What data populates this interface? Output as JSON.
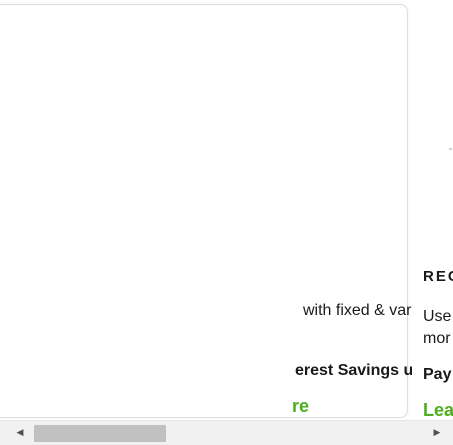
{
  "left_card": {
    "description": "with fixed & variable options, plus",
    "savings": "erest Savings until payoff*",
    "link": "re"
  },
  "right_card": {
    "heading": "REC",
    "description_line1": "Use",
    "description_line2": "mor",
    "savings": "Pay",
    "link": "Lea"
  },
  "scrollbar": {
    "left_arrow": "◀",
    "right_arrow": "▶"
  },
  "colors": {
    "link_green": "#4caf1f",
    "text": "#1a1a1a",
    "scrollbar_track": "#f1f1f1",
    "scrollbar_thumb": "#c1c1c1"
  }
}
